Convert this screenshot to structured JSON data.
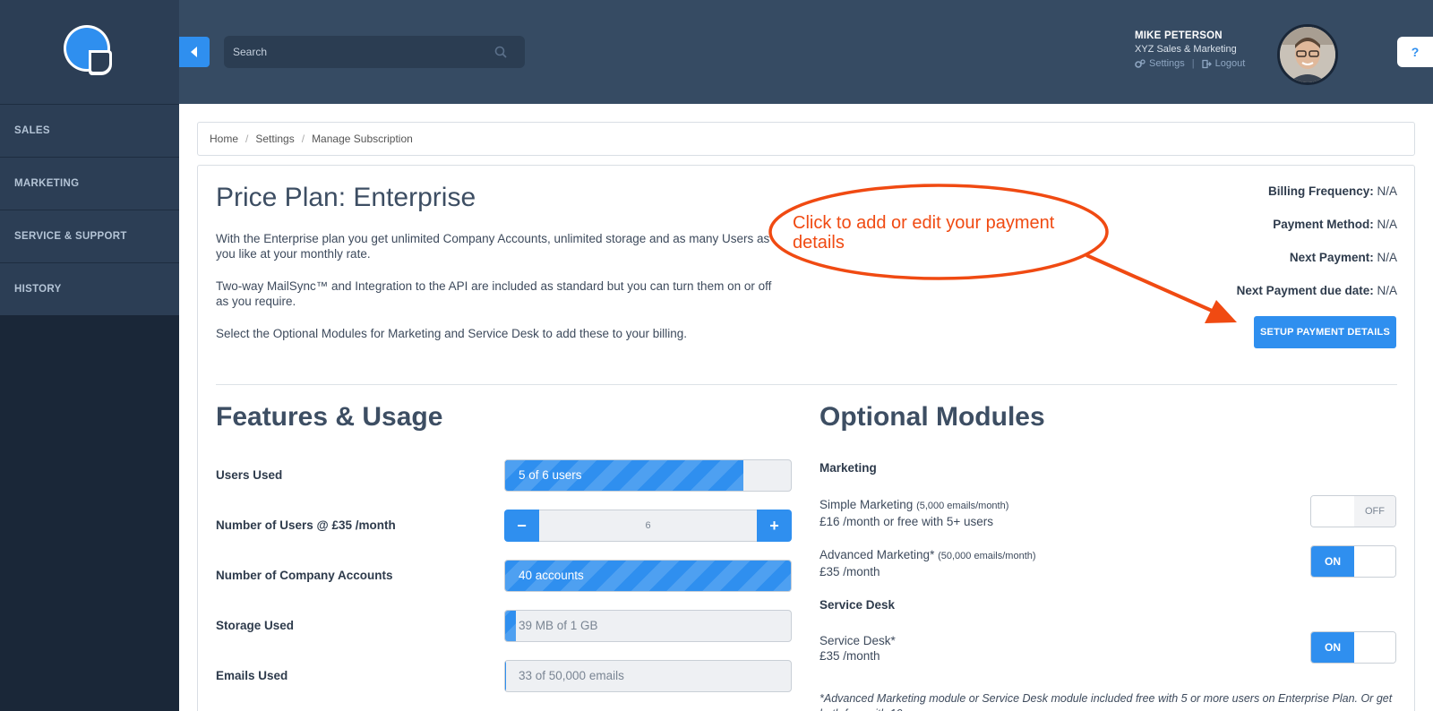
{
  "sidebar": {
    "items": [
      {
        "label": "SALES"
      },
      {
        "label": "MARKETING"
      },
      {
        "label": "SERVICE & SUPPORT"
      },
      {
        "label": "HISTORY"
      }
    ]
  },
  "header": {
    "search_placeholder": "Search",
    "user_name": "MIKE PETERSON",
    "company": "XYZ Sales & Marketing",
    "settings_label": "Settings",
    "logout_label": "Logout",
    "help_label": "?"
  },
  "breadcrumb": [
    "Home",
    "Settings",
    "Manage Subscription"
  ],
  "plan": {
    "title": "Price Plan: Enterprise",
    "paragraphs": [
      "With the Enterprise plan you get unlimited Company Accounts, unlimited storage and as many Users as you like at your monthly rate.",
      "Two-way MailSync™ and Integration to the API are included as standard but you can turn them on or off as you require.",
      "Select the Optional Modules for Marketing and Service Desk to add these to your billing."
    ]
  },
  "billing": {
    "frequency_label": "Billing Frequency:",
    "frequency_value": "N/A",
    "method_label": "Payment Method:",
    "method_value": "N/A",
    "next_label": "Next Payment:",
    "next_value": "N/A",
    "due_label": "Next Payment due date:",
    "due_value": "N/A",
    "setup_button": "SETUP PAYMENT DETAILS"
  },
  "annotation": {
    "text": "Click to add or edit your payment details"
  },
  "features": {
    "title": "Features & Usage",
    "users_used_label": "Users Used",
    "users_used_text": "5 of 6 users",
    "users_used_fraction": 0.833,
    "num_users_label": "Number of Users @ £35 /month",
    "num_users_value": "6",
    "minus": "−",
    "plus": "+",
    "company_accounts_label": "Number of Company Accounts",
    "company_accounts_text": "40 accounts",
    "company_accounts_fraction": 1.0,
    "storage_label": "Storage Used",
    "storage_text": "39 MB of 1 GB",
    "storage_fraction": 0.038,
    "emails_label": "Emails Used",
    "emails_text": "33 of 50,000 emails",
    "emails_fraction": 0.0007
  },
  "modules": {
    "title": "Optional Modules",
    "marketing_group": "Marketing",
    "simple_name": "Simple Marketing",
    "simple_note": "(5,000 emails/month)",
    "simple_price": "£16 /month or free with 5+ users",
    "simple_state": "OFF",
    "advanced_name": "Advanced Marketing*",
    "advanced_note": "(50,000 emails/month)",
    "advanced_price": "£35 /month",
    "advanced_state": "ON",
    "service_group": "Service Desk",
    "service_name": "Service Desk*",
    "service_price": "£35 /month",
    "service_state": "ON",
    "footnote": "*Advanced Marketing module or Service Desk module included free with 5 or more users on Enterprise Plan. Or get both free with 10"
  },
  "colors": {
    "accent": "#2f8fef",
    "sidebar": "#1a2738",
    "header": "#364b63",
    "annotation": "#f04a12"
  }
}
